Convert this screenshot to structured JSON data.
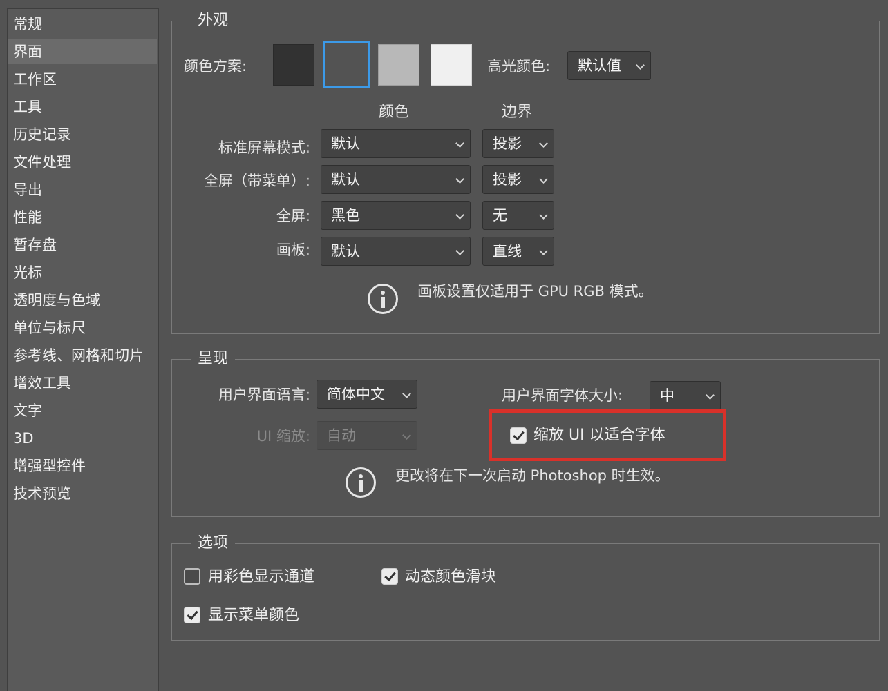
{
  "sidebar": {
    "items": [
      {
        "label": "常规"
      },
      {
        "label": "界面",
        "selected": true
      },
      {
        "label": "工作区"
      },
      {
        "label": "工具"
      },
      {
        "label": "历史记录"
      },
      {
        "label": "文件处理"
      },
      {
        "label": "导出"
      },
      {
        "label": "性能"
      },
      {
        "label": "暂存盘"
      },
      {
        "label": "光标"
      },
      {
        "label": "透明度与色域"
      },
      {
        "label": "单位与标尺"
      },
      {
        "label": "参考线、网格和切片"
      },
      {
        "label": "增效工具"
      },
      {
        "label": "文字"
      },
      {
        "label": "3D"
      },
      {
        "label": "增强型控件"
      },
      {
        "label": "技术预览"
      }
    ]
  },
  "appearance": {
    "title": "外观",
    "color_scheme_label": "颜色方案:",
    "swatches": [
      {
        "name": "darkest",
        "color": "#323232"
      },
      {
        "name": "dark",
        "color": "#535353",
        "selected": true
      },
      {
        "name": "medium-gray",
        "color": "#b8b8b8"
      },
      {
        "name": "light-gray",
        "color": "#f0f0f0"
      }
    ],
    "highlight_color_label": "高光颜色:",
    "highlight_color_value": "默认值",
    "col_color": "颜色",
    "col_border": "边界",
    "rows": [
      {
        "label": "标准屏幕模式:",
        "color": "默认",
        "border": "投影"
      },
      {
        "label": "全屏（带菜单）:",
        "color": "默认",
        "border": "投影"
      },
      {
        "label": "全屏:",
        "color": "黑色",
        "border": "无"
      },
      {
        "label": "画板:",
        "color": "默认",
        "border": "直线"
      }
    ],
    "info": "画板设置仅适用于 GPU RGB 模式。"
  },
  "presentation": {
    "title": "呈现",
    "ui_language_label": "用户界面语言:",
    "ui_language_value": "简体中文",
    "ui_font_size_label": "用户界面字体大小:",
    "ui_font_size_value": "中",
    "ui_scale_label": "UI 缩放:",
    "ui_scale_value": "自动",
    "scale_ui_to_font_label": "缩放 UI 以适合字体",
    "scale_ui_to_font_checked": true,
    "info": "更改将在下一次启动 Photoshop 时生效。",
    "highlight_color": "#d9312a"
  },
  "options": {
    "title": "选项",
    "color_channels_label": "用彩色显示通道",
    "color_channels_checked": false,
    "dynamic_sliders_label": "动态颜色滑块",
    "dynamic_sliders_checked": true,
    "menu_colors_label": "显示菜单颜色",
    "menu_colors_checked": true
  }
}
